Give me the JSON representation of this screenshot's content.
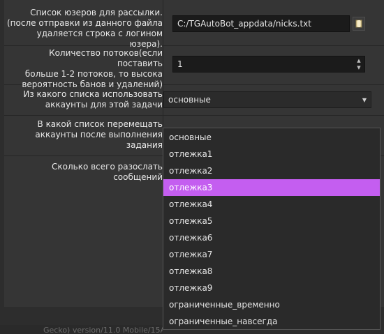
{
  "rows": [
    {
      "lines": [
        "Список юзеров для рассылки.",
        "(после отправки из данного файла",
        "удаляется строка с логином юзера)."
      ]
    },
    {
      "lines": [
        "Количество потоков(если поставить",
        "больше 1-2 потоков, то высока",
        "вероятность банов и удалений)"
      ]
    },
    {
      "lines": [
        "Из какого списка использовать",
        "аккаунты для этой задачи"
      ]
    },
    {
      "lines": [
        "В какой список перемещать",
        "аккаунты после выполнения",
        "задания"
      ]
    },
    {
      "lines": [
        "Сколько всего разослать",
        "сообщений"
      ]
    }
  ],
  "fields": {
    "file_path": "C:/TGAutoBot_appdata/nicks.txt",
    "threads": "1",
    "source_list": "основные"
  },
  "icons": {
    "browse": "folder-icon",
    "spin_up": "spin-up-arrow",
    "spin_down": "spin-down-arrow",
    "combo_arrow": "chevron-down-icon"
  },
  "dropdown": {
    "selected_index": 3,
    "options": [
      "основные",
      "отлежка1",
      "отлежка2",
      "отлежка3",
      "отлежка4",
      "отлежка5",
      "отлежка6",
      "отлежка7",
      "отлежка8",
      "отлежка9",
      "ограниченные_временно",
      "ограниченные_навсегда"
    ]
  },
  "colors": {
    "highlight": "#c45ef0",
    "background": "#353535",
    "field": "#1b1b1b"
  },
  "bottom_text": "Gecko) version/11.0 Mobile/15A5"
}
